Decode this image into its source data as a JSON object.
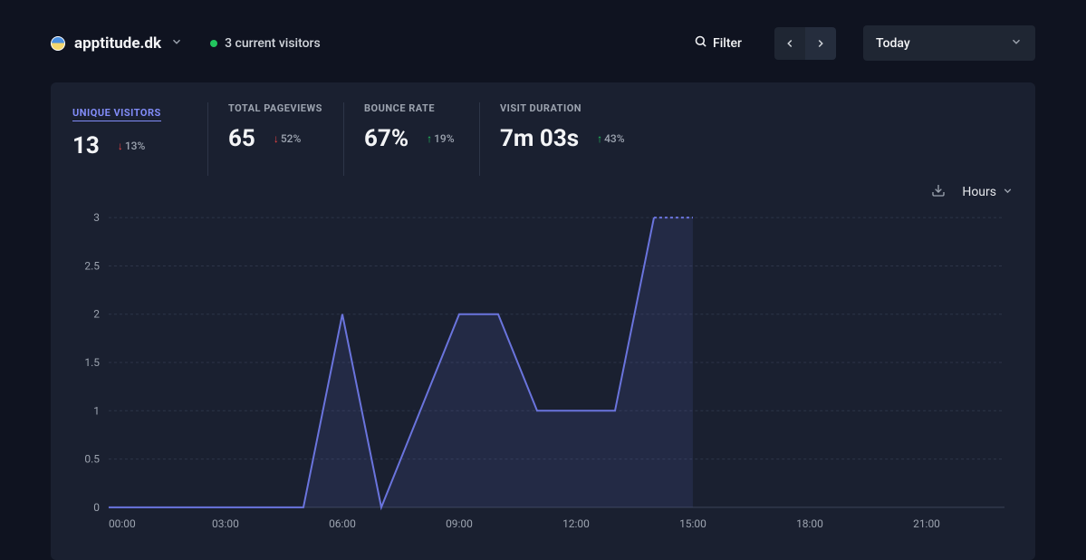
{
  "header": {
    "site_name": "apptitude.dk",
    "visitors_text": "3 current visitors",
    "filter_label": "Filter",
    "date_label": "Today"
  },
  "metrics": [
    {
      "label": "UNIQUE VISITORS",
      "value": "13",
      "change": "13%",
      "dir": "down",
      "active": true
    },
    {
      "label": "TOTAL PAGEVIEWS",
      "value": "65",
      "change": "52%",
      "dir": "down",
      "active": false
    },
    {
      "label": "BOUNCE RATE",
      "value": "67%",
      "change": "19%",
      "dir": "up",
      "active": false
    },
    {
      "label": "VISIT DURATION",
      "value": "7m 03s",
      "change": "43%",
      "dir": "up",
      "active": false
    }
  ],
  "interval_label": "Hours",
  "chart_data": {
    "type": "line",
    "title": "",
    "xlabel": "",
    "ylabel": "",
    "ylim": [
      0,
      3
    ],
    "y_ticks": [
      0,
      0.5,
      1,
      1.5,
      2,
      2.5,
      3
    ],
    "x_tick_labels": [
      "00:00",
      "03:00",
      "06:00",
      "09:00",
      "12:00",
      "15:00",
      "18:00",
      "21:00"
    ],
    "x": [
      0,
      1,
      2,
      3,
      4,
      5,
      6,
      7,
      8,
      9,
      10,
      11,
      12,
      13,
      14,
      15
    ],
    "values": [
      0,
      0,
      0,
      0,
      0,
      0,
      2,
      0,
      1,
      2,
      2,
      1,
      1,
      1,
      3,
      3
    ],
    "line_color": "#6a74dd",
    "fill_color": "rgba(106,116,221,0.12)"
  }
}
